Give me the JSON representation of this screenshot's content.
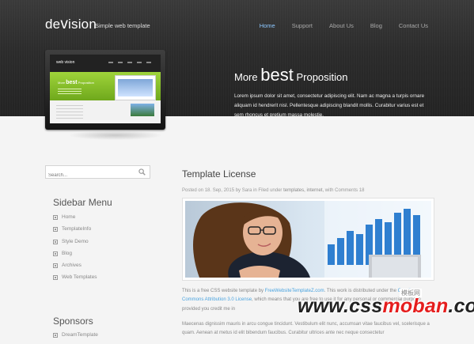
{
  "header": {
    "logo": {
      "part1": "de",
      "part2": "v",
      "part3": "ision"
    },
    "tagline": "Simple web template",
    "nav": [
      {
        "label": "Home",
        "active": true
      },
      {
        "label": "Support"
      },
      {
        "label": "About Us"
      },
      {
        "label": "Blog"
      },
      {
        "label": "Contact Us"
      }
    ]
  },
  "hero": {
    "title_pre": "More",
    "title_big": "best",
    "title_post": "Proposition",
    "text": "Lorem ipsum dolor sit amet, consectetur adipiscing elit. Nam ac magna a turpis ornare aliquam id hendrerit nisl. Pellentesque adipiscing blandit mollis. Curabitur varius est et sem rhoncus et pretium massa molestie.",
    "device_screen": {
      "logo": "web vision",
      "title_pre": "More",
      "title_big": "best",
      "title_post": "Proposition"
    }
  },
  "search": {
    "placeholder": "Search..."
  },
  "sidebar": {
    "menu_title": "Sidebar Menu",
    "menu": [
      "Home",
      "TemplateInfo",
      "Style Demo",
      "Blog",
      "Archives",
      "Web Templates"
    ],
    "sponsors_title": "Sponsors",
    "sponsors": [
      "DreamTemplate"
    ]
  },
  "post": {
    "title": "Template License",
    "meta": {
      "posted": "Posted on 18. Sep, 2015 by Sara in Filed under",
      "tags": "templates, internet,",
      "comments": "with Comments 18"
    },
    "para1": {
      "t1": "This is a free CSS website template by",
      "link1": "FreeWebsiteTemplateZ.com",
      "t2": ". This work is distributed under the",
      "link2": "Creative Commons Attribution 3.0 License",
      "t3": ", which means that you are free to use it for any personal or commercial purpose provided you credit me in"
    },
    "para2": "Maecenas dignissim mauris in arcu congue tincidunt. Vestibulum elit nunc, accumsan vitae faucibus vel, scelerisque a quam. Aenean at metus id elit bibendum faucibus. Curabitur ultrices ante nec neque consectetur"
  },
  "watermark": {
    "cn": "模板网",
    "prefix": "www.css",
    "accent": "moban",
    "suffix": ".com"
  }
}
